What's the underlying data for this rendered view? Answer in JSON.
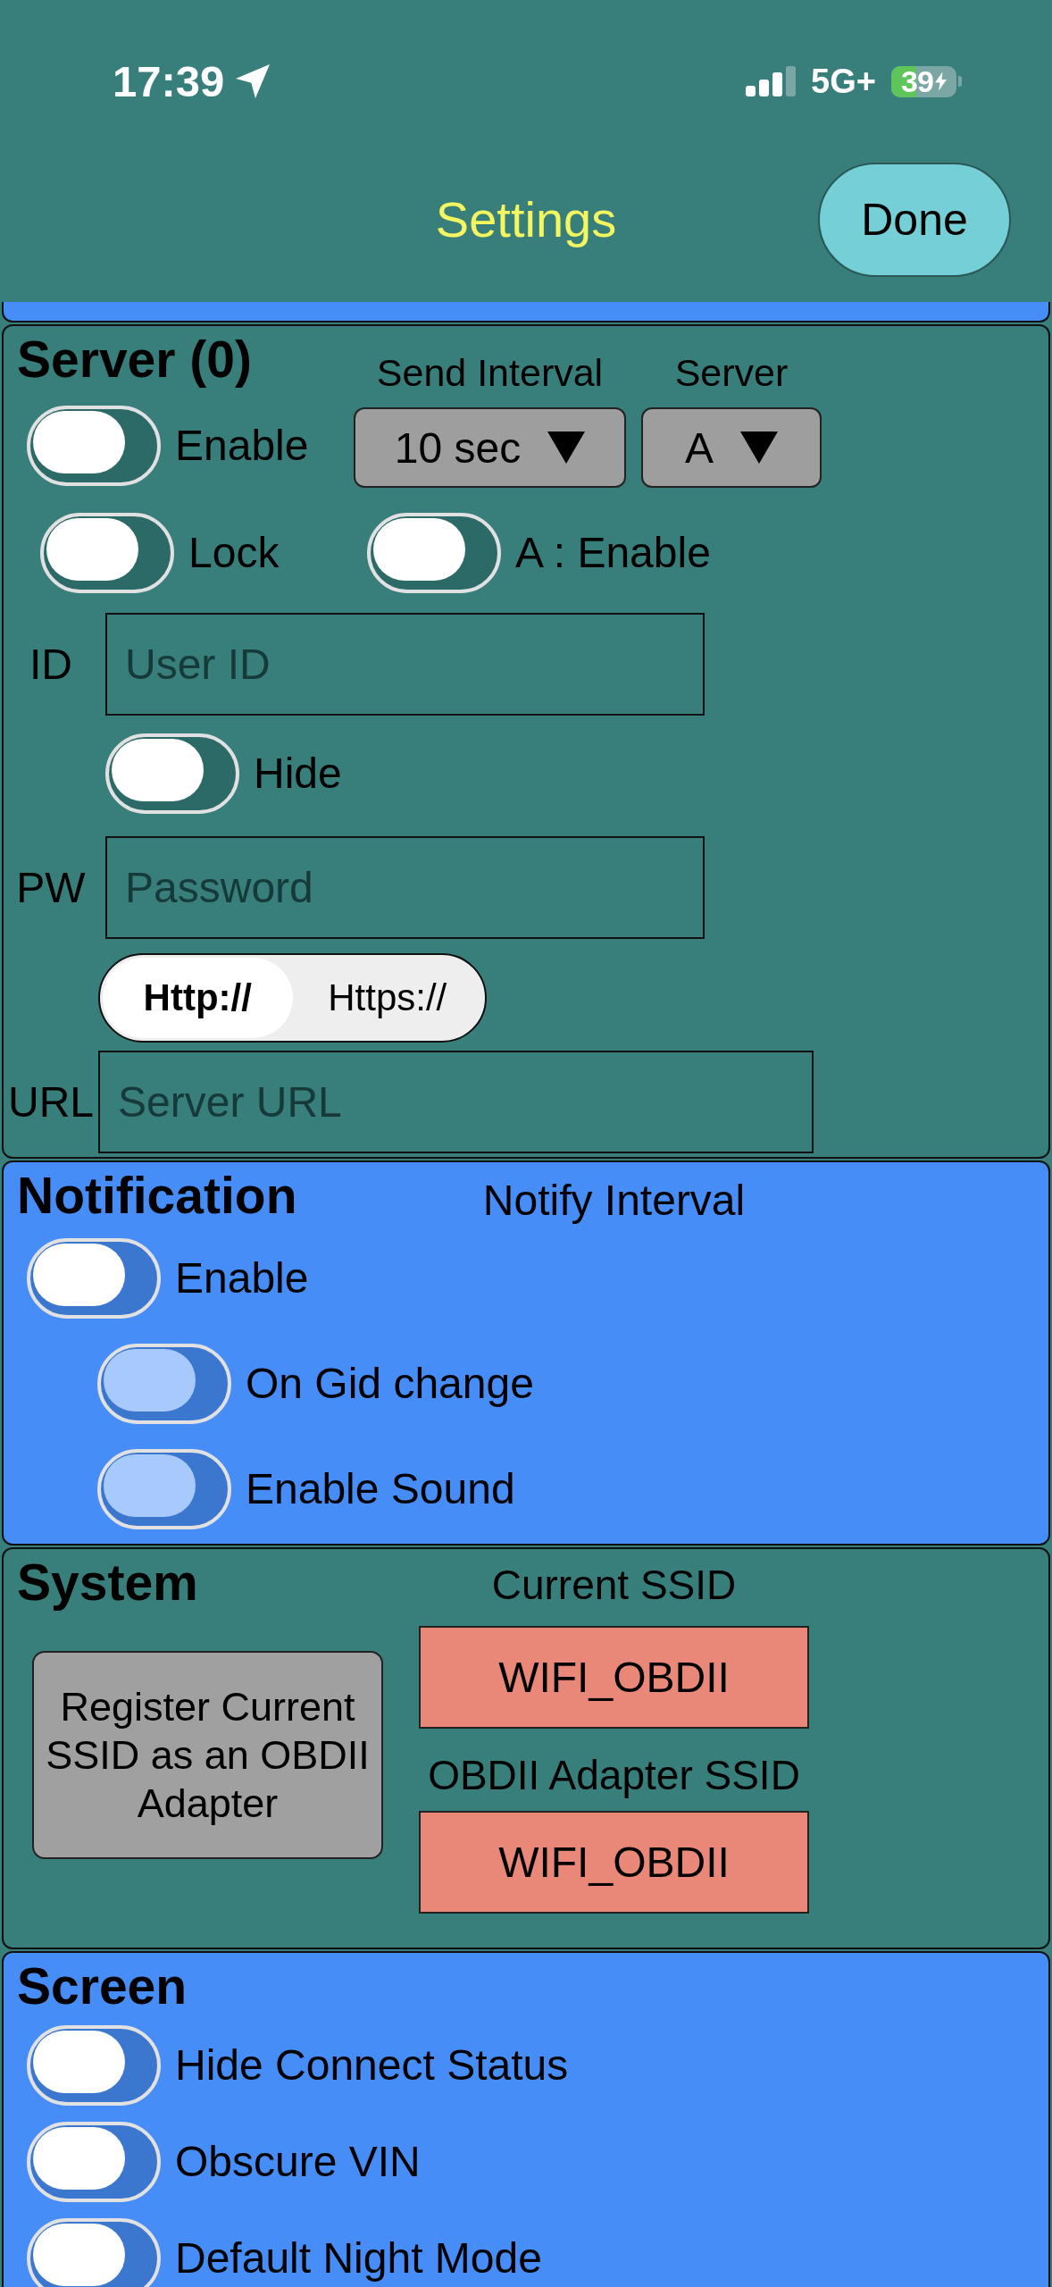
{
  "status_bar": {
    "time": "17:39",
    "network": "5G+",
    "battery": "39"
  },
  "nav_bar": {
    "title": "Settings",
    "done_button": "Done"
  },
  "sections": [
    {
      "kind": "server",
      "title": "Server (0)",
      "enable": {
        "label": "Enable",
        "on": false
      },
      "send_interval": {
        "label": "Send Interval",
        "value": "10 sec"
      },
      "server_select": {
        "label": "Server",
        "value": "A"
      },
      "lock": {
        "label": "Lock",
        "on": false
      },
      "server_enable": {
        "label": "A : Enable",
        "on": false
      },
      "id_field": {
        "label": "ID",
        "placeholder": "User ID"
      },
      "hide_password": {
        "label": "Hide",
        "on": false
      },
      "pw_field": {
        "label": "PW",
        "placeholder": "Password"
      },
      "protocol": [
        {
          "label": "Http://",
          "selected": true
        },
        {
          "label": "Https://",
          "selected": false
        }
      ],
      "url_field": {
        "label": "URL",
        "placeholder": "Server URL"
      }
    },
    {
      "kind": "notification",
      "title": "Notification",
      "notify_interval_label": "Notify Interval",
      "toggles": [
        {
          "label": "Enable",
          "on": false,
          "disabled": false,
          "children": [
            {
              "label": "On Gid change",
              "on": false,
              "disabled": true
            },
            {
              "label": "Enable Sound",
              "on": false,
              "disabled": true
            }
          ]
        }
      ]
    },
    {
      "kind": "system",
      "title": "System",
      "register_button": "Register Current SSID as an OBDII Adapter",
      "current_ssid": {
        "label": "Current SSID",
        "value": "WIFI_OBDII"
      },
      "adapter_ssid": {
        "label": "OBDII Adapter SSID",
        "value": "WIFI_OBDII"
      }
    },
    {
      "kind": "screen",
      "title": "Screen",
      "toggles": [
        {
          "label": "Hide Connect Status",
          "on": false
        },
        {
          "label": "Obscure VIN",
          "on": false
        },
        {
          "label": "Default Night Mode",
          "on": false
        }
      ]
    }
  ]
}
